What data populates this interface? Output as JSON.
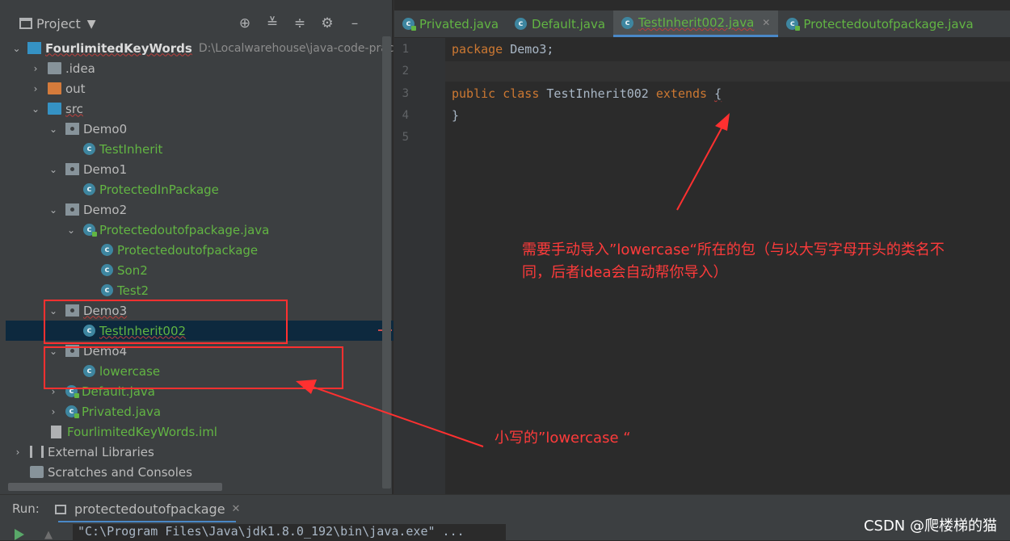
{
  "project_panel": {
    "title": "Project",
    "tree": [
      {
        "label": "FourlimitedKeyWords",
        "path": "D:\\Localwarehouse\\java-code-pract"
      },
      {
        "label": ".idea"
      },
      {
        "label": "out"
      },
      {
        "label": "src"
      },
      {
        "label": "Demo0"
      },
      {
        "label": "TestInherit"
      },
      {
        "label": "Demo1"
      },
      {
        "label": "ProtectedInPackage"
      },
      {
        "label": "Demo2"
      },
      {
        "label": "Protectedoutofpackage.java"
      },
      {
        "label": "Protectedoutofpackage"
      },
      {
        "label": "Son2"
      },
      {
        "label": "Test2"
      },
      {
        "label": "Demo3"
      },
      {
        "label": "TestInherit002"
      },
      {
        "label": "Demo4"
      },
      {
        "label": "lowercase"
      },
      {
        "label": "Default.java"
      },
      {
        "label": "Privated.java"
      },
      {
        "label": "FourlimitedKeyWords.iml"
      },
      {
        "label": "External Libraries"
      },
      {
        "label": "Scratches and Consoles"
      }
    ]
  },
  "editor": {
    "tabs": [
      {
        "label": "Privated.java"
      },
      {
        "label": "Default.java"
      },
      {
        "label": "TestInherit002.java"
      },
      {
        "label": "Protectedoutofpackage.java"
      }
    ],
    "line_numbers": [
      "1",
      "2",
      "3",
      "4",
      "5"
    ],
    "code": {
      "l1_kw": "package",
      "l1_rest": " Demo3;",
      "l3_kw1": "public",
      "l3_kw2": "class",
      "l3_name": "TestInherit002",
      "l3_kw3": "extends",
      "l3_brace": "{",
      "l4": "}"
    }
  },
  "annotations": {
    "note_top_line1": "需要手动导入”lowercase“所在的包（与以大写字母开头的类名不",
    "note_top_line2": "同，后者idea会自动帮你导入）",
    "note_bottom": "小写的”lowercase “",
    "color": "#ff3b3b"
  },
  "run_bar": {
    "label": "Run:",
    "tab": "protectedoutofpackage",
    "console_line": "\"C:\\Program Files\\Java\\jdk1.8.0_192\\bin\\java.exe\" ...",
    "watermark": "CSDN @爬楼梯的猫"
  },
  "colors": {
    "panel_bg": "#3c3f41",
    "editor_bg": "#2b2b2b",
    "keyword": "#cc7832",
    "modified_file": "#62b543",
    "selection": "#0d293e"
  }
}
